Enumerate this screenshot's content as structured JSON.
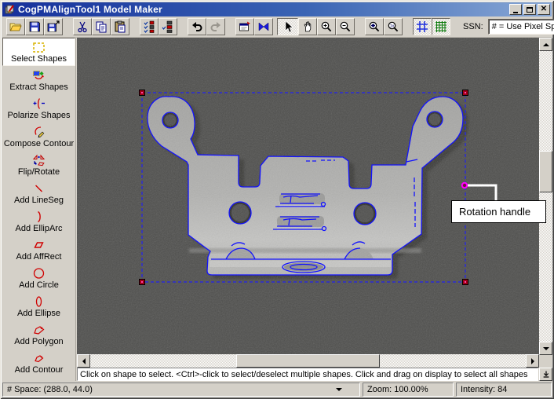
{
  "window": {
    "title": "CogPMAlignTool1 Model Maker"
  },
  "toolbar": {
    "ssn_label": "SSN:",
    "ssn_value": "# = Use Pixel Space"
  },
  "sidebar": {
    "items": [
      {
        "label": "Select Shapes"
      },
      {
        "label": "Extract Shapes"
      },
      {
        "label": "Polarize Shapes"
      },
      {
        "label": "Compose Contour"
      },
      {
        "label": "Flip/Rotate"
      },
      {
        "label": "Add LineSeg"
      },
      {
        "label": "Add EllipArc"
      },
      {
        "label": "Add AffRect"
      },
      {
        "label": "Add Circle"
      },
      {
        "label": "Add Ellipse"
      },
      {
        "label": "Add Polygon"
      },
      {
        "label": "Add Contour"
      }
    ]
  },
  "canvas": {
    "callout_label": "Rotation handle"
  },
  "message_bar": {
    "text": "Click on shape to select. <Ctrl>-click to select/deselect multiple shapes. Click and drag on display to select all shapes"
  },
  "statusbar": {
    "space": "# Space:  (288.0, 44.0)",
    "zoom": "Zoom:  100.00%",
    "intensity": "Intensity: 84"
  },
  "colors": {
    "contour_blue": "#1212ff",
    "marquee_blue": "#2222ee",
    "handle_red": "#a00018",
    "rotation_handle_magenta": "#ff00ff",
    "canvas_background": "#4e4e4c"
  }
}
